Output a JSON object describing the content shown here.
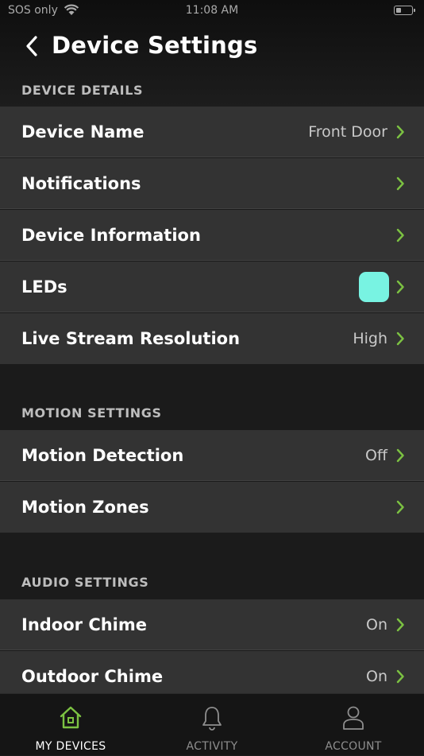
{
  "status_bar": {
    "carrier": "SOS only",
    "time": "11:08 AM"
  },
  "header": {
    "title": "Device Settings"
  },
  "sections": [
    {
      "title": "DEVICE DETAILS",
      "rows": [
        {
          "label": "Device Name",
          "value": "Front Door"
        },
        {
          "label": "Notifications",
          "value": ""
        },
        {
          "label": "Device Information",
          "value": ""
        },
        {
          "label": "LEDs",
          "value": "",
          "swatch_color": "#78f3e2"
        },
        {
          "label": "Live Stream Resolution",
          "value": "High"
        }
      ]
    },
    {
      "title": "MOTION SETTINGS",
      "rows": [
        {
          "label": "Motion Detection",
          "value": "Off"
        },
        {
          "label": "Motion Zones",
          "value": ""
        }
      ]
    },
    {
      "title": "AUDIO SETTINGS",
      "rows": [
        {
          "label": "Indoor Chime",
          "value": "On"
        },
        {
          "label": "Outdoor Chime",
          "value": "On"
        }
      ]
    }
  ],
  "tabbar": {
    "tabs": [
      {
        "label": "MY DEVICES",
        "icon": "home-icon",
        "active": true
      },
      {
        "label": "ACTIVITY",
        "icon": "bell-icon",
        "active": false
      },
      {
        "label": "ACCOUNT",
        "icon": "user-icon",
        "active": false
      }
    ]
  },
  "colors": {
    "accent": "#7cc242",
    "led": "#78f3e2",
    "row_bg": "#333333",
    "page_bg": "#1b1b1b"
  }
}
